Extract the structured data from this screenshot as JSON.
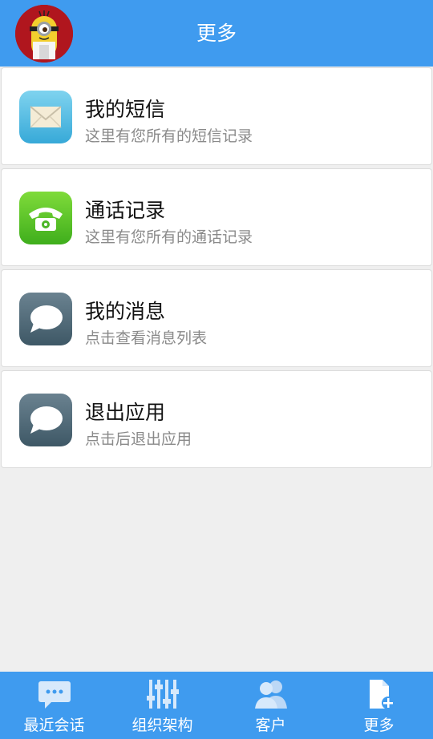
{
  "header": {
    "title": "更多"
  },
  "menu": {
    "items": [
      {
        "title": "我的短信",
        "subtitle": "这里有您所有的短信记录",
        "icon": "envelope-icon"
      },
      {
        "title": "通话记录",
        "subtitle": "这里有您所有的通话记录",
        "icon": "phone-icon"
      },
      {
        "title": "我的消息",
        "subtitle": "点击查看消息列表",
        "icon": "chat-bubble-icon"
      },
      {
        "title": "退出应用",
        "subtitle": "点击后退出应用",
        "icon": "chat-bubble-icon"
      }
    ]
  },
  "tabbar": {
    "tabs": [
      {
        "label": "最近会话",
        "icon": "chat-dots-icon"
      },
      {
        "label": "组织架构",
        "icon": "sliders-icon"
      },
      {
        "label": "客户",
        "icon": "people-icon"
      },
      {
        "label": "更多",
        "icon": "document-add-icon"
      }
    ]
  },
  "colors": {
    "primary": "#3f9bef",
    "background": "#efefef"
  }
}
